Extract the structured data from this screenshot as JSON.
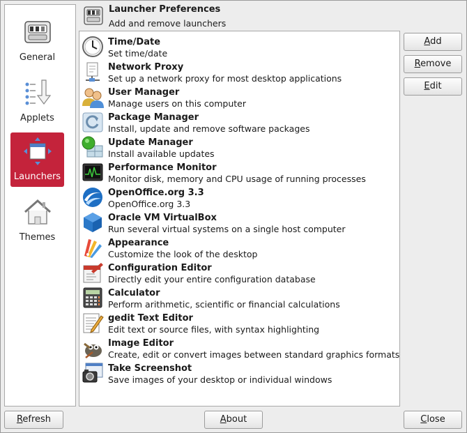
{
  "sidebar": {
    "items": [
      {
        "label": "General",
        "icon": "toggle-switches-icon"
      },
      {
        "label": "Applets",
        "icon": "applets-arrow-icon"
      },
      {
        "label": "Launchers",
        "icon": "launchers-window-icon",
        "active": true
      },
      {
        "label": "Themes",
        "icon": "house-icon"
      }
    ]
  },
  "header": {
    "title": "Launcher Preferences",
    "subtitle": "Add and remove launchers"
  },
  "launchers": [
    {
      "name": "Time/Date",
      "desc": "Set time/date",
      "icon": "clock-icon"
    },
    {
      "name": "Network Proxy",
      "desc": "Set up a network proxy for most desktop applications",
      "icon": "network-proxy-icon"
    },
    {
      "name": "User Manager",
      "desc": "Manage users on this computer",
      "icon": "users-icon"
    },
    {
      "name": "Package Manager",
      "desc": "Install, update and remove software packages",
      "icon": "package-icon"
    },
    {
      "name": "Update Manager",
      "desc": "Install available updates",
      "icon": "update-icon"
    },
    {
      "name": "Performance Monitor",
      "desc": "Monitor disk, memory and CPU usage of running processes",
      "icon": "monitor-icon"
    },
    {
      "name": "OpenOffice.org 3.3",
      "desc": "OpenOffice.org 3.3",
      "icon": "openoffice-icon"
    },
    {
      "name": "Oracle VM VirtualBox",
      "desc": "Run several virtual systems on a single host computer",
      "icon": "virtualbox-icon"
    },
    {
      "name": "Appearance",
      "desc": "Customize the look of the desktop",
      "icon": "appearance-icon"
    },
    {
      "name": "Configuration Editor",
      "desc": "Directly edit your entire configuration database",
      "icon": "config-editor-icon"
    },
    {
      "name": "Calculator",
      "desc": "Perform arithmetic, scientific or financial calculations",
      "icon": "calculator-icon"
    },
    {
      "name": "gedit Text Editor",
      "desc": "Edit text or source files, with syntax highlighting",
      "icon": "text-editor-icon"
    },
    {
      "name": "Image Editor",
      "desc": "Create, edit or convert images between standard graphics formats",
      "icon": "gimp-icon"
    },
    {
      "name": "Take Screenshot",
      "desc": "Save images of your desktop or individual windows",
      "icon": "screenshot-icon"
    }
  ],
  "buttons": {
    "add": {
      "mnemonic": "A",
      "rest": "dd"
    },
    "remove": {
      "mnemonic": "R",
      "rest": "emove"
    },
    "edit": {
      "mnemonic": "E",
      "rest": "dit"
    },
    "refresh": {
      "mnemonic": "R",
      "rest": "efresh"
    },
    "about": {
      "mnemonic": "A",
      "rest": "bout"
    },
    "close": {
      "mnemonic": "C",
      "rest": "lose"
    }
  },
  "colors": {
    "accent": "#c4233b"
  }
}
